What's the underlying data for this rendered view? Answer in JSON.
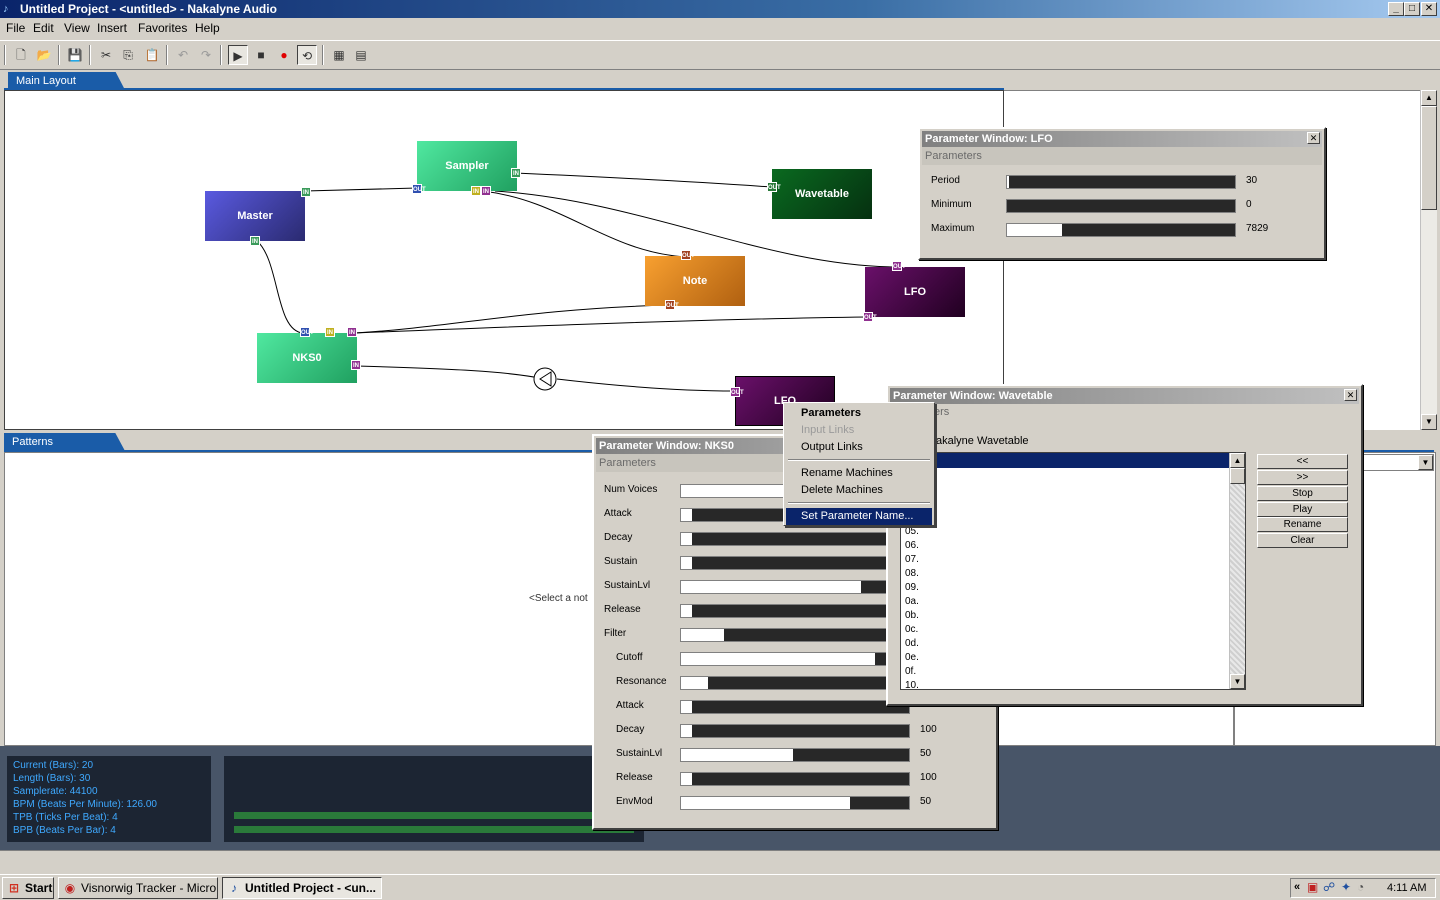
{
  "window": {
    "title": "Untitled Project - <untitled> - Nakalyne Audio",
    "min_label": "_",
    "max_label": "□",
    "close_label": "✕"
  },
  "menu": [
    "File",
    "Edit",
    "View",
    "Insert",
    "Favorites",
    "Help"
  ],
  "tabs": {
    "main_layout": "Main Layout",
    "patterns": "Patterns"
  },
  "machines": {
    "master": "Master",
    "sampler": "Sampler",
    "wavetable": "Wavetable",
    "note": "Note",
    "lfo": "LFO",
    "nks0": "NKS0",
    "lfo2": "LFO"
  },
  "ports": {
    "in": "IN",
    "out": "OUT"
  },
  "patterns": {
    "hint": "<Select a not"
  },
  "info": {
    "current": "Current (Bars): 20",
    "length": "Length (Bars): 30",
    "samplerate": "Samplerate: 44100",
    "bpm": "BPM (Beats Per Minute): 126.00",
    "tpb": "TPB (Ticks Per Beat): 4",
    "bpb": "BPB (Beats Per Bar): 4"
  },
  "lfo_window": {
    "title": "Parameter Window: LFO",
    "subtitle": "Parameters",
    "close": "✕",
    "params": [
      {
        "label": "Period",
        "fraction": 0.01,
        "value": "30"
      },
      {
        "label": "Minimum",
        "fraction": 0.0,
        "value": "0"
      },
      {
        "label": "Maximum",
        "fraction": 0.24,
        "value": "7829"
      }
    ]
  },
  "nks0_window": {
    "title": "Parameter Window: NKS0",
    "subtitle": "Parameters",
    "params": [
      {
        "label": "Num Voices",
        "fraction": 0.5,
        "value": ""
      },
      {
        "label": "Attack",
        "fraction": 0.05,
        "value": ""
      },
      {
        "label": "Decay",
        "fraction": 0.05,
        "value": ""
      },
      {
        "label": "Sustain",
        "fraction": 0.05,
        "value": ""
      },
      {
        "label": "SustainLvl",
        "fraction": 0.79,
        "value": ""
      },
      {
        "label": "Release",
        "fraction": 0.05,
        "value": ""
      },
      {
        "label": "Filter",
        "fraction": 0.19,
        "value": ""
      },
      {
        "label": "Cutoff",
        "fraction": 0.85,
        "value": ""
      },
      {
        "label": "Resonance",
        "fraction": 0.12,
        "value": ""
      },
      {
        "label": "Attack",
        "fraction": 0.05,
        "value": ""
      },
      {
        "label": "Decay",
        "fraction": 0.05,
        "value": "100"
      },
      {
        "label": "SustainLvl",
        "fraction": 0.49,
        "value": "50"
      },
      {
        "label": "Release",
        "fraction": 0.05,
        "value": "100"
      },
      {
        "label": "EnvMod",
        "fraction": 0.74,
        "value": "50"
      }
    ]
  },
  "wavetable_window": {
    "title": "Parameter Window: Wavetable",
    "subtitle": "ers",
    "close": "✕",
    "name": "akalyne Wavetable",
    "rows": [
      "05.",
      "06.",
      "07.",
      "08.",
      "09.",
      "0a.",
      "0b.",
      "0c.",
      "0d.",
      "0e.",
      "0f.",
      "10."
    ],
    "buttons": [
      "<<",
      ">>",
      "Stop",
      "Play",
      "Rename",
      "Clear"
    ]
  },
  "context_menu": {
    "parameters": "Parameters",
    "input_links": "Input Links",
    "output_links": "Output Links",
    "rename": "Rename Machines",
    "delete": "Delete Machines",
    "set_param": "Set Parameter Name..."
  },
  "taskbar": {
    "start": "Start",
    "task1": "Visnorwig Tracker - Micro...",
    "task2": "Untitled Project - <un...",
    "clock": "4:11 AM",
    "tray_expand": "«"
  },
  "colors": {
    "master": "#4a4ac8",
    "sampler": "#40d890",
    "wavetable": "#0a5a1a",
    "note": "#e88820",
    "lfo": "#4a0a4a",
    "selection": "#0a246a"
  }
}
